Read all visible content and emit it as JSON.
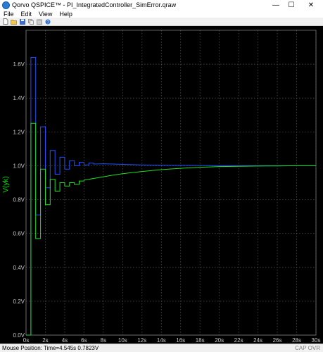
{
  "window": {
    "title": "Qorvo QSPICE™ - PI_IntegratedController_SimError.qraw",
    "minimize": "—",
    "maximize": "☐",
    "close": "✕"
  },
  "menu": [
    "File",
    "Edit",
    "View",
    "Help"
  ],
  "toolbar": {
    "icons": [
      "new-icon",
      "open-icon",
      "save-icon",
      "copy-icon",
      "paste-icon",
      "help-icon"
    ]
  },
  "status": {
    "mouse_position": "Mouse Position: Time=4.545s  0.7823V",
    "indicators": "CAP  OVR"
  },
  "chart_data": {
    "type": "line",
    "ylabel": "V(yk)",
    "ylabel_color": "#00e000",
    "xlim": [
      0,
      30
    ],
    "ylim": [
      0,
      1.8
    ],
    "grid": true,
    "x_ticks": [
      "0s",
      "2s",
      "4s",
      "6s",
      "8s",
      "10s",
      "12s",
      "14s",
      "16s",
      "18s",
      "20s",
      "22s",
      "24s",
      "26s",
      "28s",
      "30s"
    ],
    "y_ticks": [
      "0.0V",
      "0.2V",
      "0.4V",
      "0.6V",
      "0.8V",
      "1.0V",
      "1.2V",
      "1.4V",
      "1.6V"
    ],
    "series": [
      {
        "color": "#2050ff",
        "x": [
          0,
          0.5,
          0.5,
          1,
          1,
          1.5,
          1.5,
          2,
          2,
          2.5,
          2.5,
          3,
          3,
          3.5,
          3.5,
          4,
          4,
          4.5,
          4.5,
          5,
          5,
          5.5,
          5.5,
          6,
          6,
          6.5,
          6.5,
          7,
          7,
          8,
          9,
          10,
          12,
          15,
          20,
          30
        ],
        "y": [
          0,
          0,
          1.64,
          1.64,
          0.71,
          0.71,
          1.23,
          1.23,
          0.87,
          0.87,
          1.09,
          1.09,
          0.95,
          0.95,
          1.05,
          1.05,
          0.98,
          0.98,
          1.03,
          1.03,
          1.0,
          1.0,
          1.02,
          1.02,
          1.005,
          1.005,
          1.015,
          1.015,
          1.01,
          1.012,
          1.01,
          1.008,
          1.005,
          1.003,
          1.0,
          1.0
        ]
      },
      {
        "color": "#20e020",
        "x": [
          0,
          0.5,
          0.5,
          1,
          1,
          1.5,
          1.5,
          2,
          2,
          2.5,
          2.5,
          3,
          3,
          3.5,
          3.5,
          4,
          4,
          4.5,
          4.5,
          5,
          5,
          5.5,
          5.5,
          6,
          6,
          7,
          8,
          9,
          10,
          11,
          12,
          13,
          14,
          15,
          16,
          17,
          18,
          19,
          20,
          22,
          24,
          26,
          28,
          30
        ],
        "y": [
          0,
          0,
          1.25,
          1.25,
          0.57,
          0.57,
          0.98,
          0.98,
          0.77,
          0.77,
          0.92,
          0.92,
          0.85,
          0.85,
          0.9,
          0.9,
          0.88,
          0.88,
          0.9,
          0.9,
          0.89,
          0.89,
          0.91,
          0.91,
          0.915,
          0.925,
          0.935,
          0.945,
          0.953,
          0.96,
          0.966,
          0.972,
          0.977,
          0.981,
          0.985,
          0.988,
          0.991,
          0.993,
          0.995,
          0.997,
          0.998,
          0.999,
          1.0,
          1.0
        ]
      }
    ]
  }
}
